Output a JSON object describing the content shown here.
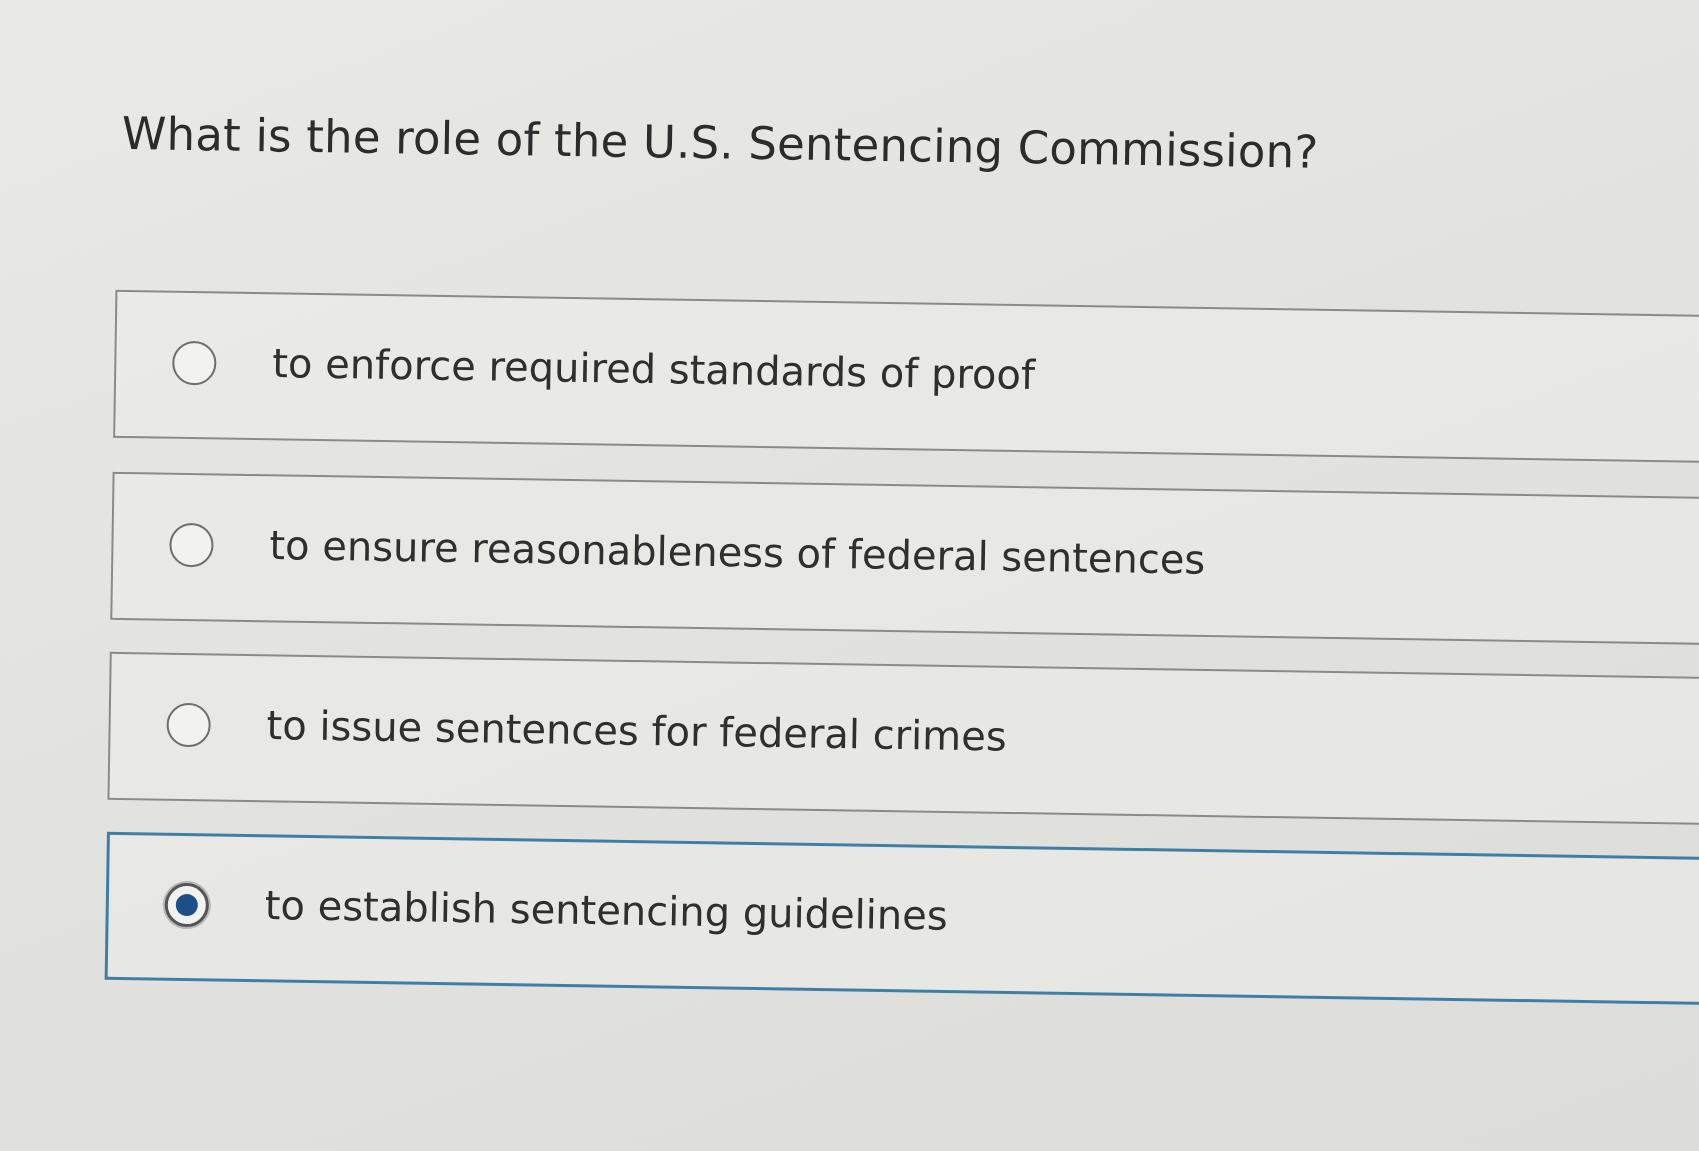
{
  "question": {
    "text": "What is the role of the U.S. Sentencing Commission?"
  },
  "options": [
    {
      "label": "to enforce required standards of proof",
      "selected": false
    },
    {
      "label": "to ensure reasonableness of federal sentences",
      "selected": false
    },
    {
      "label": "to issue sentences for federal crimes",
      "selected": false
    },
    {
      "label": "to establish sentencing guidelines",
      "selected": true
    }
  ],
  "colors": {
    "selected_border": "#3f7fa6",
    "radio_fill": "#1d4f86",
    "text": "#2f2f2f"
  }
}
